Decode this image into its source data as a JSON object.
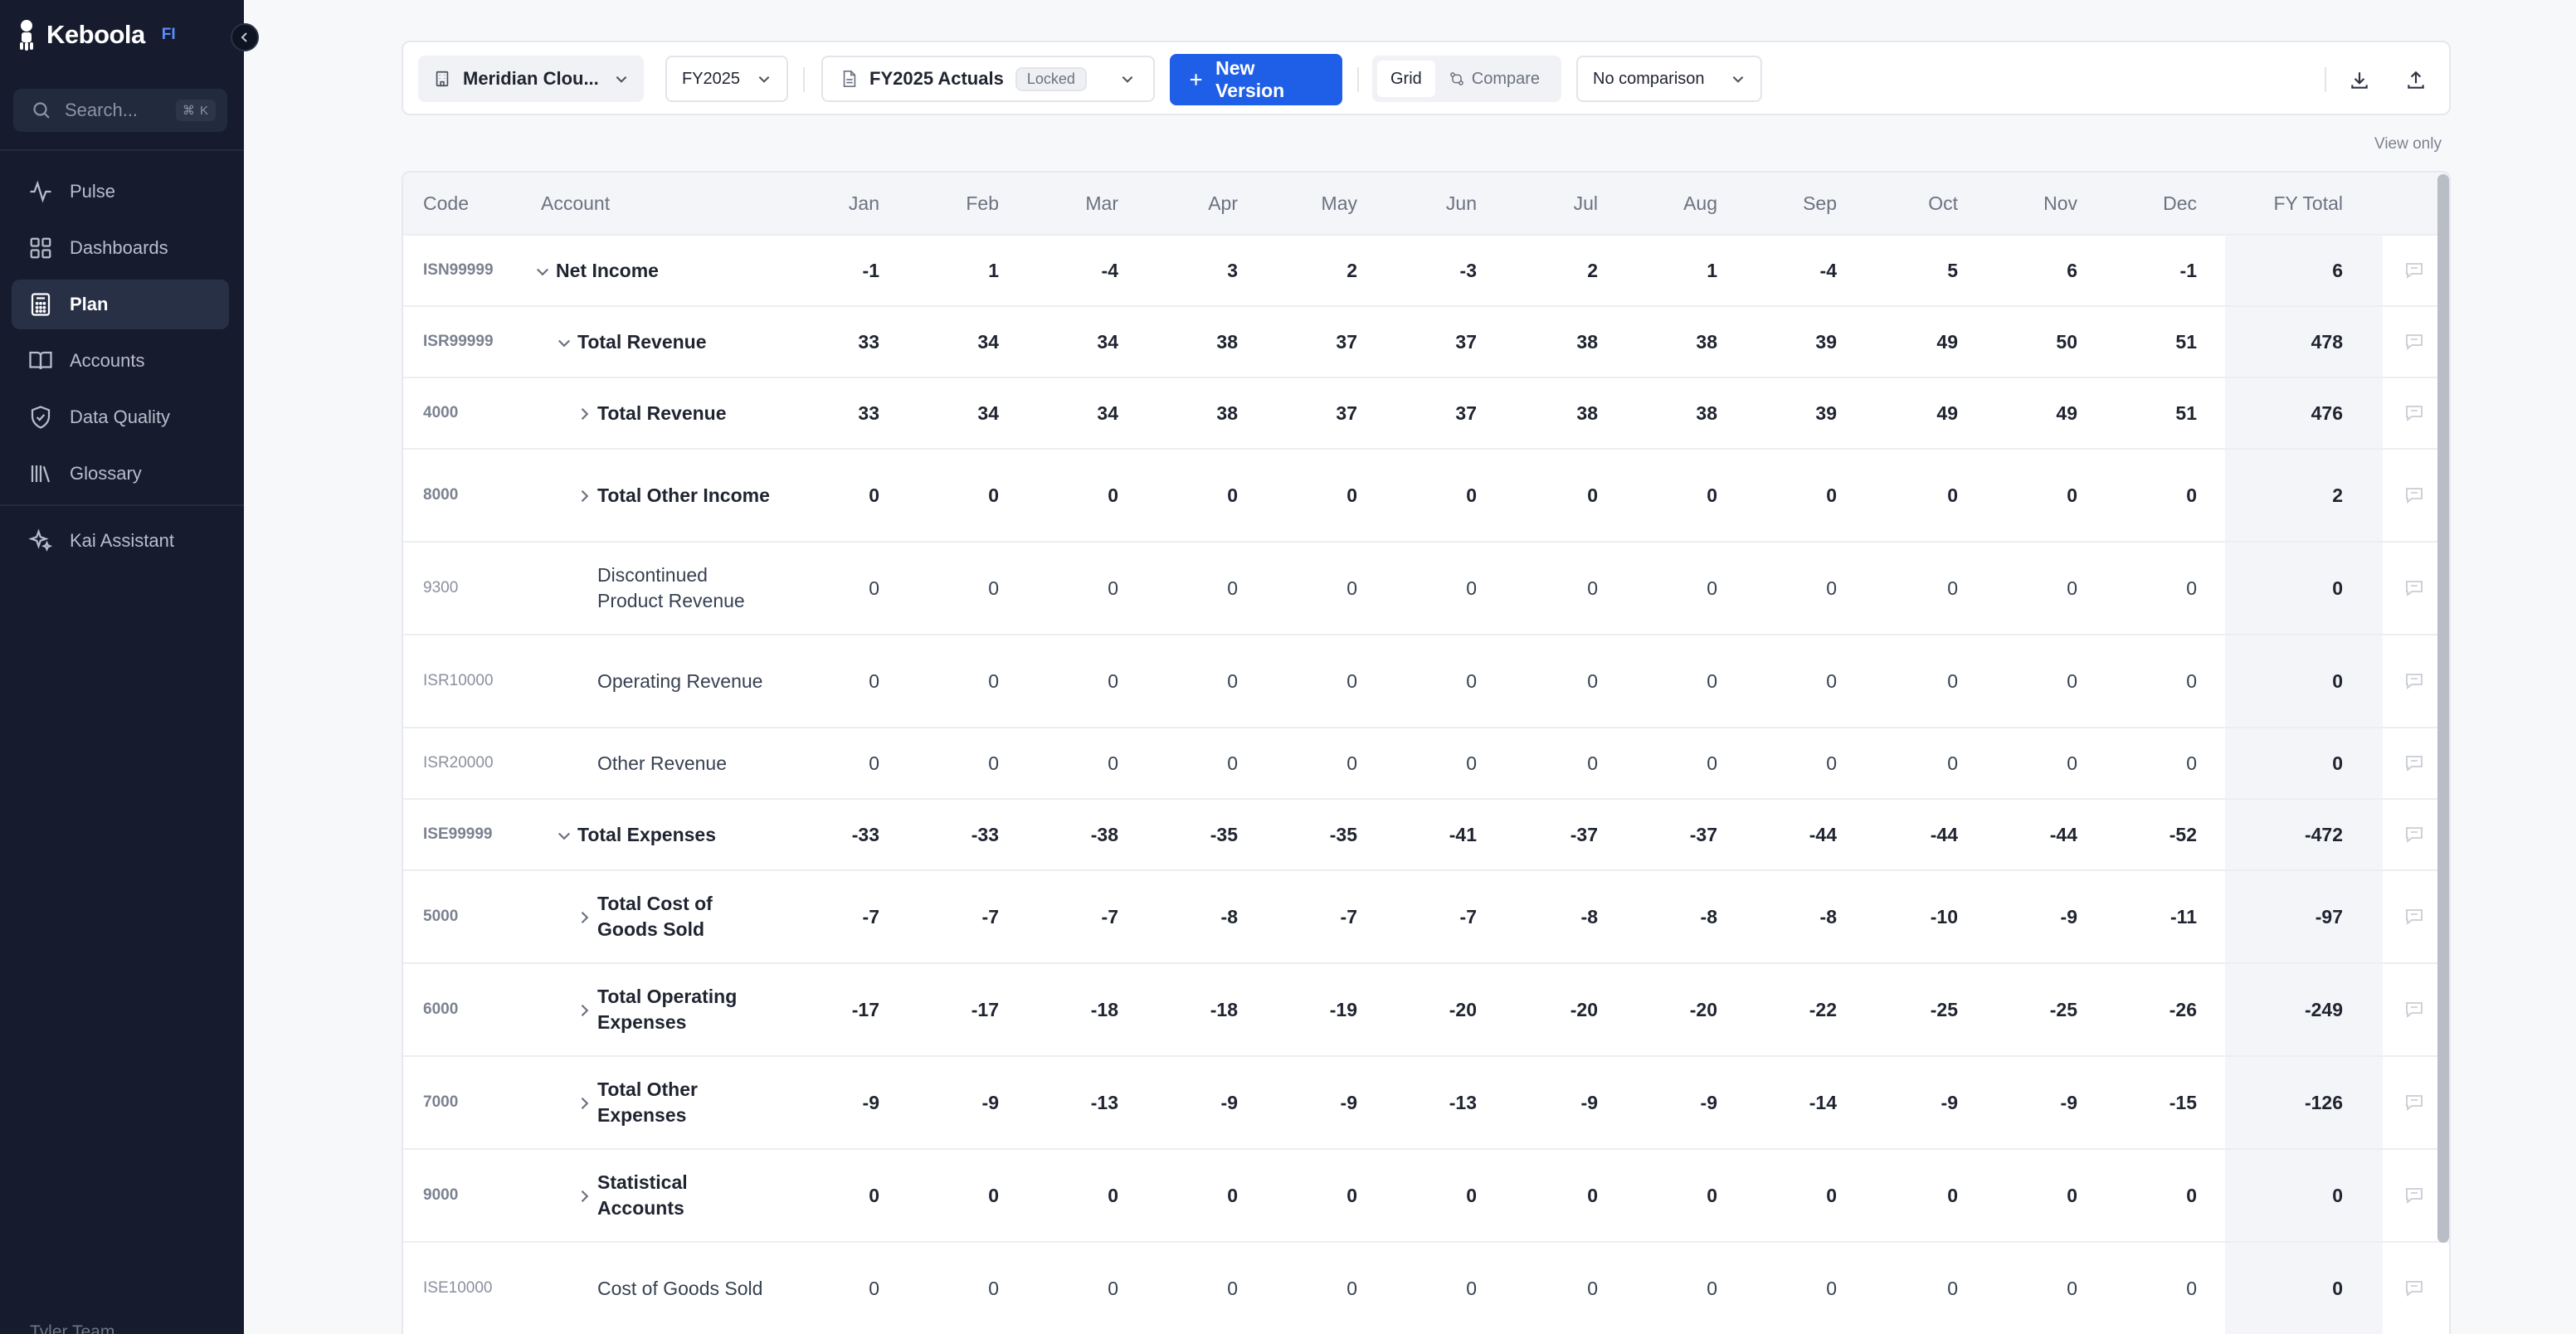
{
  "app": {
    "name": "Keboola",
    "badge": "FI"
  },
  "sidebar": {
    "search": {
      "placeholder": "Search...",
      "shortcut": "⌘ K"
    },
    "items": [
      {
        "label": "Pulse",
        "icon": "activity-icon",
        "active": false
      },
      {
        "label": "Dashboards",
        "icon": "dashboard-icon",
        "active": false
      },
      {
        "label": "Plan",
        "icon": "calculator-icon",
        "active": true
      },
      {
        "label": "Accounts",
        "icon": "book-icon",
        "active": false
      },
      {
        "label": "Data Quality",
        "icon": "shield-check-icon",
        "active": false
      },
      {
        "label": "Glossary",
        "icon": "library-icon",
        "active": false
      },
      {
        "label": "Kai Assistant",
        "icon": "sparkles-icon",
        "active": false
      }
    ],
    "bottom_label": "Tyler Team"
  },
  "toolbar": {
    "company": "Meridian Clou...",
    "fiscal_year": "FY2025",
    "version_name": "FY2025 Actuals",
    "version_status": "Locked",
    "new_version_label": "New Version",
    "view_grid": "Grid",
    "view_compare": "Compare",
    "comparison": "No comparison"
  },
  "view_only_label": "View only",
  "grid": {
    "headers": [
      "Code",
      "Account",
      "Jan",
      "Feb",
      "Mar",
      "Apr",
      "May",
      "Jun",
      "Jul",
      "Aug",
      "Sep",
      "Oct",
      "Nov",
      "Dec",
      "FY Total"
    ],
    "rows": [
      {
        "code": "ISN99999",
        "account": "Net Income",
        "level": 0,
        "expander": "expanded",
        "bold": true,
        "values": [
          "-1",
          "1",
          "-4",
          "3",
          "2",
          "-3",
          "2",
          "1",
          "-4",
          "5",
          "6",
          "-1"
        ],
        "total": "6"
      },
      {
        "code": "ISR99999",
        "account": "Total Revenue",
        "level": 1,
        "expander": "expanded",
        "bold": true,
        "values": [
          "33",
          "34",
          "34",
          "38",
          "37",
          "37",
          "38",
          "38",
          "39",
          "49",
          "50",
          "51"
        ],
        "total": "478"
      },
      {
        "code": "4000",
        "account": "Total Revenue",
        "level": 2,
        "expander": "collapsed",
        "bold": true,
        "values": [
          "33",
          "34",
          "34",
          "38",
          "37",
          "37",
          "38",
          "38",
          "39",
          "49",
          "49",
          "51"
        ],
        "total": "476"
      },
      {
        "code": "8000",
        "account": "Total Other Income",
        "level": 2,
        "expander": "collapsed",
        "bold": true,
        "values": [
          "0",
          "0",
          "0",
          "0",
          "0",
          "0",
          "0",
          "0",
          "0",
          "0",
          "0",
          "0"
        ],
        "total": "2"
      },
      {
        "code": "9300",
        "account": "Discontinued Product Revenue",
        "level": 2,
        "expander": "none",
        "bold": false,
        "values": [
          "0",
          "0",
          "0",
          "0",
          "0",
          "0",
          "0",
          "0",
          "0",
          "0",
          "0",
          "0"
        ],
        "total": "0"
      },
      {
        "code": "ISR10000",
        "account": "Operating Revenue",
        "level": 2,
        "expander": "none",
        "bold": false,
        "values": [
          "0",
          "0",
          "0",
          "0",
          "0",
          "0",
          "0",
          "0",
          "0",
          "0",
          "0",
          "0"
        ],
        "total": "0"
      },
      {
        "code": "ISR20000",
        "account": "Other Revenue",
        "level": 2,
        "expander": "none",
        "bold": false,
        "values": [
          "0",
          "0",
          "0",
          "0",
          "0",
          "0",
          "0",
          "0",
          "0",
          "0",
          "0",
          "0"
        ],
        "total": "0"
      },
      {
        "code": "ISE99999",
        "account": "Total Expenses",
        "level": 1,
        "expander": "expanded",
        "bold": true,
        "values": [
          "-33",
          "-33",
          "-38",
          "-35",
          "-35",
          "-41",
          "-37",
          "-37",
          "-44",
          "-44",
          "-44",
          "-52"
        ],
        "total": "-472"
      },
      {
        "code": "5000",
        "account": "Total Cost of Goods Sold",
        "level": 2,
        "expander": "collapsed",
        "bold": true,
        "values": [
          "-7",
          "-7",
          "-7",
          "-8",
          "-7",
          "-7",
          "-8",
          "-8",
          "-8",
          "-10",
          "-9",
          "-11"
        ],
        "total": "-97"
      },
      {
        "code": "6000",
        "account": "Total Operating Expenses",
        "level": 2,
        "expander": "collapsed",
        "bold": true,
        "values": [
          "-17",
          "-17",
          "-18",
          "-18",
          "-19",
          "-20",
          "-20",
          "-20",
          "-22",
          "-25",
          "-25",
          "-26"
        ],
        "total": "-249"
      },
      {
        "code": "7000",
        "account": "Total Other Expenses",
        "level": 2,
        "expander": "collapsed",
        "bold": true,
        "values": [
          "-9",
          "-9",
          "-13",
          "-9",
          "-9",
          "-13",
          "-9",
          "-9",
          "-14",
          "-9",
          "-9",
          "-15"
        ],
        "total": "-126"
      },
      {
        "code": "9000",
        "account": "Statistical Accounts",
        "level": 2,
        "expander": "collapsed",
        "bold": true,
        "values": [
          "0",
          "0",
          "0",
          "0",
          "0",
          "0",
          "0",
          "0",
          "0",
          "0",
          "0",
          "0"
        ],
        "total": "0"
      },
      {
        "code": "ISE10000",
        "account": "Cost of Goods Sold",
        "level": 2,
        "expander": "none",
        "bold": false,
        "values": [
          "0",
          "0",
          "0",
          "0",
          "0",
          "0",
          "0",
          "0",
          "0",
          "0",
          "0",
          "0"
        ],
        "total": "0"
      }
    ]
  }
}
